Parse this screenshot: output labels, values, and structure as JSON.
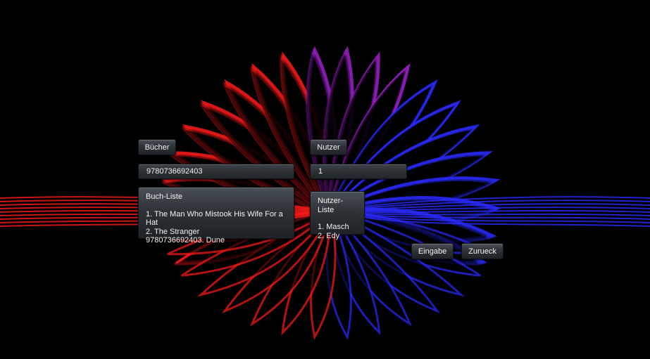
{
  "books": {
    "button_label": "Bücher",
    "input_value": "9780736692403",
    "list_title": "Buch-Liste",
    "items": [
      "1. The Man Who Mistook His Wife For a Hat",
      "2. The Stranger",
      "9780736692403. Dune"
    ]
  },
  "users": {
    "button_label": "Nutzer",
    "input_value": "1",
    "list_title": "Nutzer-Liste",
    "items": [
      "1. Masch",
      "2. Edy"
    ]
  },
  "actions": {
    "enter_label": "Eingabe",
    "back_label": "Zurueck"
  },
  "colors": {
    "background": "#000000",
    "petal_red": "#ff1a1a",
    "petal_blue": "#2a2aff",
    "widget_top": "#4a5058",
    "widget_bottom": "#1f2327"
  }
}
